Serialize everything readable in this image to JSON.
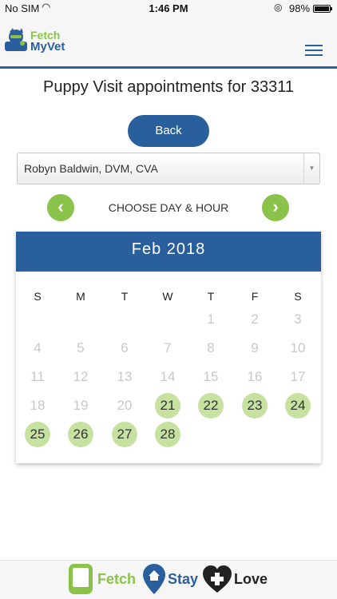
{
  "status_bar": {
    "carrier": "No SIM",
    "time": "1:46 PM",
    "battery": "98%"
  },
  "header": {
    "logo_line1": "Fetch",
    "logo_line2": "MyVet"
  },
  "page": {
    "title": "Puppy Visit appointments for 33311",
    "back_label": "Back",
    "vet_selected": "Robyn Baldwin, DVM, CVA",
    "choose_label": "CHOOSE DAY & HOUR"
  },
  "calendar": {
    "month_label": "Feb 2018",
    "weekdays": [
      "S",
      "M",
      "T",
      "W",
      "T",
      "F",
      "S"
    ],
    "days": [
      "1",
      "2",
      "3",
      "4",
      "5",
      "6",
      "7",
      "8",
      "9",
      "10",
      "11",
      "12",
      "13",
      "14",
      "15",
      "16",
      "17",
      "18",
      "19",
      "20",
      "21",
      "22",
      "23",
      "24",
      "25",
      "26",
      "27",
      "28"
    ],
    "available_days": [
      "21",
      "22",
      "23",
      "24",
      "25",
      "26",
      "27",
      "28"
    ]
  },
  "footer": {
    "word1": "Fetch",
    "word2": "Stay",
    "word3": "Love"
  },
  "colors": {
    "brand_blue": "#2a5f9e",
    "brand_green": "#8bc34a",
    "available_day": "#c7e2a0"
  }
}
